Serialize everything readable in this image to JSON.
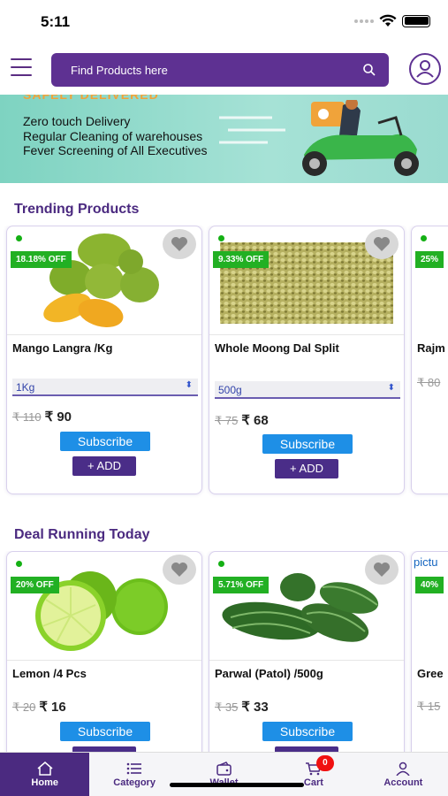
{
  "status": {
    "time": "5:11"
  },
  "search": {
    "placeholder": "Find Products here"
  },
  "banner": {
    "partial_text": "SAFELY DELIVERED",
    "lines": [
      "Zero touch Delivery",
      "Regular Cleaning of warehouses",
      "Fever Screening of All Executives"
    ]
  },
  "trending": {
    "title": "Trending Products",
    "products": [
      {
        "name": "Mango Langra /Kg",
        "discount": "18.18% OFF",
        "variant": "1Kg",
        "old_price": "₹ 110",
        "price": "₹ 90",
        "subscribe": "Subscribe",
        "add": "+ ADD"
      },
      {
        "name": "Whole Moong Dal Split",
        "discount": "9.33% OFF",
        "variant": "500g",
        "old_price": "₹ 75",
        "price": "₹ 68",
        "subscribe": "Subscribe",
        "add": "+ ADD"
      },
      {
        "name": "Rajm",
        "discount": "25% ",
        "old_price": "₹ 80"
      }
    ]
  },
  "deals": {
    "title": "Deal Running Today",
    "products": [
      {
        "name": "Lemon /4 Pcs",
        "discount": "20% OFF",
        "old_price": "₹ 20",
        "price": "₹ 16",
        "subscribe": "Subscribe"
      },
      {
        "name": "Parwal (Patol) /500g",
        "discount": "5.71% OFF",
        "old_price": "₹ 35",
        "price": "₹ 33",
        "subscribe": "Subscribe"
      },
      {
        "name": "Gree",
        "discount": "40% ",
        "logo": "pictu",
        "old_price": "₹ 15"
      }
    ]
  },
  "tabs": [
    {
      "label": "Home",
      "icon": "home-icon"
    },
    {
      "label": "Category",
      "icon": "list-icon"
    },
    {
      "label": "Wallet",
      "icon": "wallet-icon"
    },
    {
      "label": "Cart",
      "icon": "cart-icon",
      "badge": "0"
    },
    {
      "label": "Account",
      "icon": "account-icon"
    }
  ],
  "colors": {
    "brand": "#5e3192",
    "accent": "#1e8fe6",
    "discount": "#22b023"
  }
}
